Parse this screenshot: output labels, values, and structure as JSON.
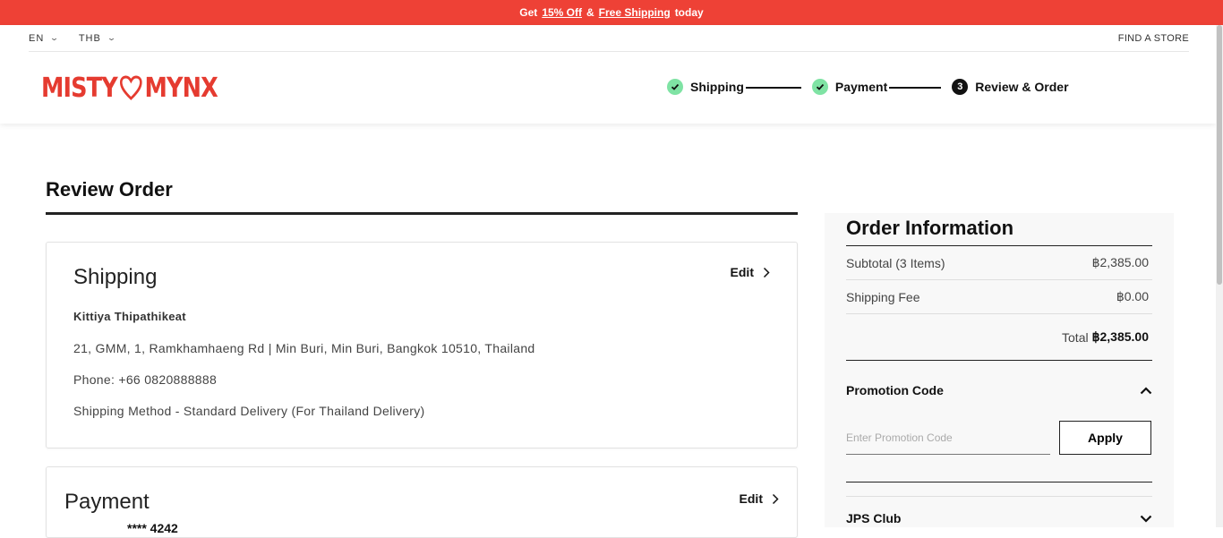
{
  "promo_bar": {
    "prefix": "Get",
    "discount_link": "15% Off",
    "amp": "&",
    "shipping_link": "Free Shipping",
    "suffix": "today"
  },
  "util": {
    "language": "EN",
    "currency": "THB",
    "find_store": "FIND A STORE"
  },
  "logo": {
    "left": "MISTY",
    "right": "MYNX",
    "icon": "heart-icon",
    "color": "#e53b30"
  },
  "steps": [
    {
      "label": "Shipping",
      "state": "done"
    },
    {
      "label": "Payment",
      "state": "done"
    },
    {
      "label": "Review & Order",
      "state": "current",
      "number": "3"
    }
  ],
  "page_title": "Review Order",
  "shipping": {
    "heading": "Shipping",
    "edit_label": "Edit",
    "name": "Kittiya Thipathikeat",
    "address": "21, GMM, 1, Ramkhamhaeng Rd | Min Buri, Min Buri, Bangkok 10510, Thailand",
    "phone": "Phone: +66 0820888888",
    "method": "Shipping Method  - Standard Delivery (For Thailand Delivery)"
  },
  "payment": {
    "heading": "Payment",
    "edit_label": "Edit",
    "card_number": "**** 4242"
  },
  "order_info": {
    "title": "Order Information",
    "subtotal_label": "Subtotal (3 Items)",
    "subtotal_value": "฿2,385.00",
    "shipping_fee_label": "Shipping Fee",
    "shipping_fee_value": "฿0.00",
    "total_label": "Total",
    "total_value": "฿2,385.00",
    "promo_heading": "Promotion Code",
    "promo_placeholder": "Enter Promotion Code",
    "apply_label": "Apply",
    "jps_heading": "JPS Club"
  },
  "colors": {
    "promo_bar": "#ee4136",
    "step_done": "#7fe3a4",
    "brand": "#e53b30"
  }
}
